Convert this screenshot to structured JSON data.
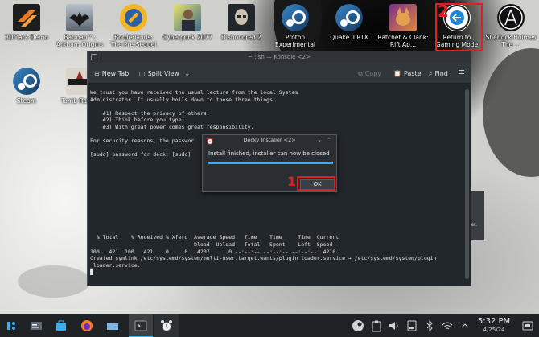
{
  "desktop_icons": [
    {
      "label": "3DMark Demo",
      "icon": "3dmark-icon"
    },
    {
      "label": "Batman™: Arkham Origins",
      "icon": "batman-icon"
    },
    {
      "label": "Borderlands: The Pre-Sequel",
      "icon": "borderlands-icon"
    },
    {
      "label": "Cyberpunk 2077",
      "icon": "cyberpunk-icon"
    },
    {
      "label": "Dishonored 2",
      "icon": "dishonored-icon"
    },
    {
      "label": "Proton Experimental",
      "icon": "steam-icon"
    },
    {
      "label": "Quake II RTX",
      "icon": "steam-icon"
    },
    {
      "label": "Ratchet & Clank: Rift Ap...",
      "icon": "ratchet-icon"
    },
    {
      "label": "Return to Gaming Mode",
      "icon": "return-to-gaming-mode-icon"
    },
    {
      "label": "Sherlock Holmes The ...",
      "icon": "sherlock-icon"
    },
    {
      "label": "Steam",
      "icon": "steam-icon"
    },
    {
      "label": "Tomb Raid...",
      "icon": "tomb-raider-icon"
    }
  ],
  "callouts": {
    "first": "1",
    "second": "2"
  },
  "konsole": {
    "title": "~ : sh — Konsole <2>",
    "toolbar": {
      "new_tab": "New Tab",
      "split_view": "Split View",
      "copy": "Copy",
      "paste": "Paste",
      "find": "Find"
    },
    "terminal_text": "We trust you have received the usual lecture from the local System\nAdministrator. It usually boils down to these three things:\n\n    #1) Respect the privacy of others.\n    #2) Think before you type.\n    #3) With great power comes great responsibility.\n\nFor security reasons, the passwor\n\n[sudo] password for deck: [sudo]\n\n\n\n\n\n\n\n\n\n\n\n  % Total    % Received % Xferd  Average Speed   Time    Time     Time  Current\n                                 Dload  Upload   Total   Spent    Left  Speed\n100   421  100   421    0     0   4207      0 --:--:-- --:--:-- --:--:--  4210\nCreated symlink /etc/systemd/system/multi-user.target.wants/plugin_loader.service → /etc/systemd/system/plugin\n_loader.service.\n"
  },
  "dialog": {
    "title": "Decky Installer <2>",
    "message": "Install finished, installer can now be closed",
    "progress_percent": 100,
    "ok_label": "OK"
  },
  "peek_window": {
    "text": "ader."
  },
  "taskbar": {
    "time": "5:32 PM",
    "date": "4/25/24"
  },
  "colors": {
    "accent": "#3daee9",
    "callout": "#e02020",
    "terminal_bg": "#22272b",
    "taskbar_bg": "#1f2326"
  }
}
